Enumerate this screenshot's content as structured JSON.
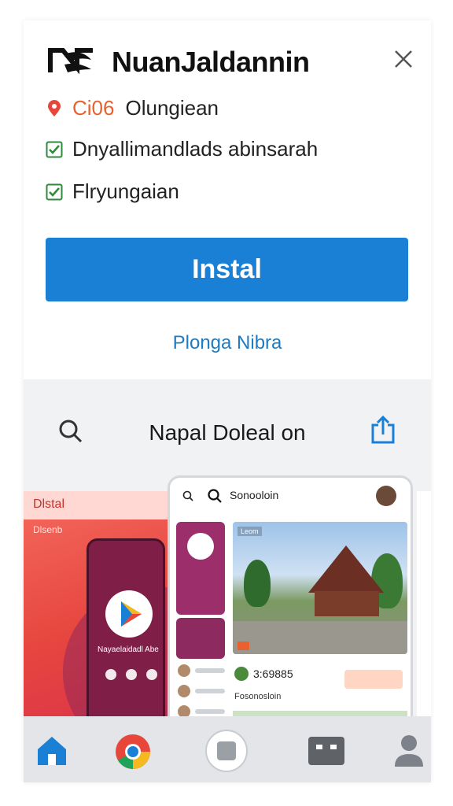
{
  "install_card": {
    "title": "NuanJaldannin",
    "location_code": "Ci06",
    "location_name": "Olungiean",
    "feature_1": "Dnyallimandlads abinsarah",
    "feature_2": "Flryungaian",
    "install_button": "Instal",
    "more_link": "Plonga Nibra"
  },
  "browser_bar": {
    "title": "Napal Doleal on"
  },
  "screenshots": {
    "left": {
      "tag": "Dlstal",
      "sub": "Dlsenb",
      "caption": "Nayaelaidadl Abe"
    },
    "main": {
      "search_text": "Sonooloin",
      "photo_label": "Leom",
      "stat_value": "3:69885",
      "sub_text": "Fosonosloin"
    }
  },
  "colors": {
    "accent_blue": "#1a80d6",
    "link_blue": "#1c7bc2",
    "location_red": "#e8463a",
    "check_green": "#2f8a3d"
  },
  "bottom_nav": {
    "icons": [
      "home-icon",
      "chrome-icon",
      "square-button-icon",
      "tabs-icon",
      "profile-icon"
    ]
  }
}
